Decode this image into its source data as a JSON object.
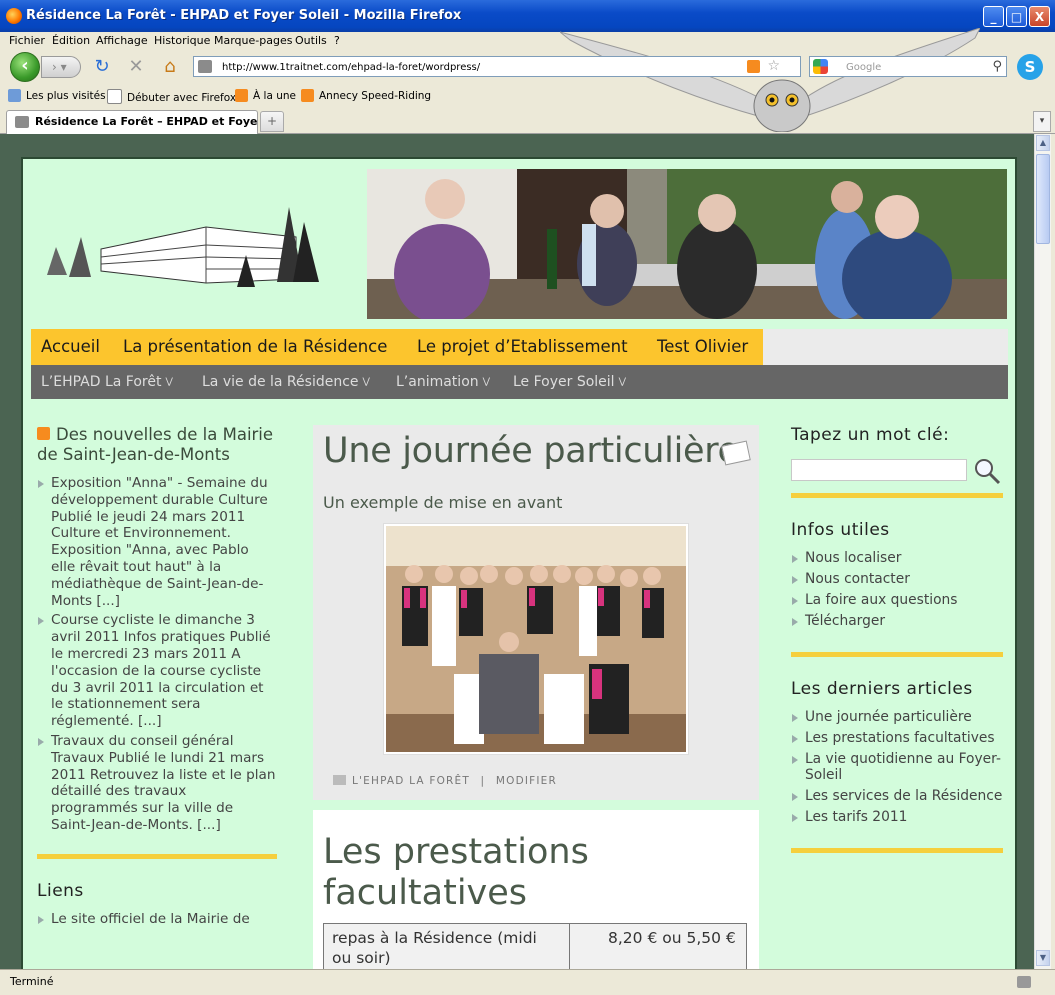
{
  "window": {
    "title": "Résidence La Forêt - EHPAD et Foyer Soleil - Mozilla Firefox",
    "minimize": "_",
    "maximize": "□",
    "close": "X"
  },
  "menu": [
    "Fichier",
    "Édition",
    "Affichage",
    "Historique",
    "Marque-pages",
    "Outils",
    "?"
  ],
  "toolbar": {
    "url": "http://www.1traitnet.com/ehpad-la-foret/wordpress/",
    "search_placeholder": "Google"
  },
  "bookmarks": [
    "Les plus visités",
    "Débuter avec Firefox",
    "À la une",
    "Annecy Speed-Riding"
  ],
  "tab": {
    "title": "Résidence La Forêt – EHPAD et Foyer...",
    "new_tab": "+"
  },
  "status": "Terminé",
  "site": {
    "main_nav": [
      "Accueil",
      "La présentation de la Résidence",
      "Le projet d’Etablissement",
      "Test Olivier"
    ],
    "sub_nav": [
      "L’EHPAD La Forêt",
      "La vie de la Résidence",
      "L’animation",
      "Le Foyer Soleil"
    ],
    "left": {
      "feed_title": "Des nouvelles de la Mairie de Saint-Jean-de-Monts",
      "feed_items": [
        "Exposition \"Anna\" - Semaine du développement durable Culture Publié le jeudi 24 mars 2011 Culture et Environnement. Exposition \"Anna, avec Pablo elle rêvait tout haut\" à la médiathèque de Saint-Jean-de-Monts [...]",
        "Course cycliste le dimanche 3 avril 2011 Infos pratiques Publié le mercredi 23 mars 2011 A l'occasion de la course cycliste du 3 avril 2011 la circulation et le stationnement sera réglementé. [...]",
        "Travaux du conseil général Travaux Publié le lundi 21 mars 2011 Retrouvez la liste et le plan détaillé des travaux programmés sur la ville de Saint-Jean-de-Monts. [...]"
      ],
      "links_title": "Liens",
      "links_first": "Le site officiel de la Mairie de"
    },
    "post1": {
      "title": "Une journée particulière",
      "subtitle": "Un exemple de mise en avant",
      "category": "L'EHPAD LA FORÊT",
      "separator": "|",
      "edit": "MODIFIER"
    },
    "post2": {
      "title": "Les prestations facultatives",
      "row1_label": "repas à la Résidence (midi ou soir)",
      "row1_price": "8,20 € ou 5,50 €"
    },
    "right": {
      "search_title": "Tapez un mot clé:",
      "infos_title": "Infos utiles",
      "infos": [
        "Nous localiser",
        "Nous contacter",
        "La foire aux questions",
        "Télécharger"
      ],
      "articles_title": "Les derniers articles",
      "articles": [
        "Une journée particulière",
        "Les prestations facultatives",
        "La vie quotidienne au Foyer-Soleil",
        "Les services de la Résidence",
        "Les tarifs 2011"
      ]
    }
  }
}
